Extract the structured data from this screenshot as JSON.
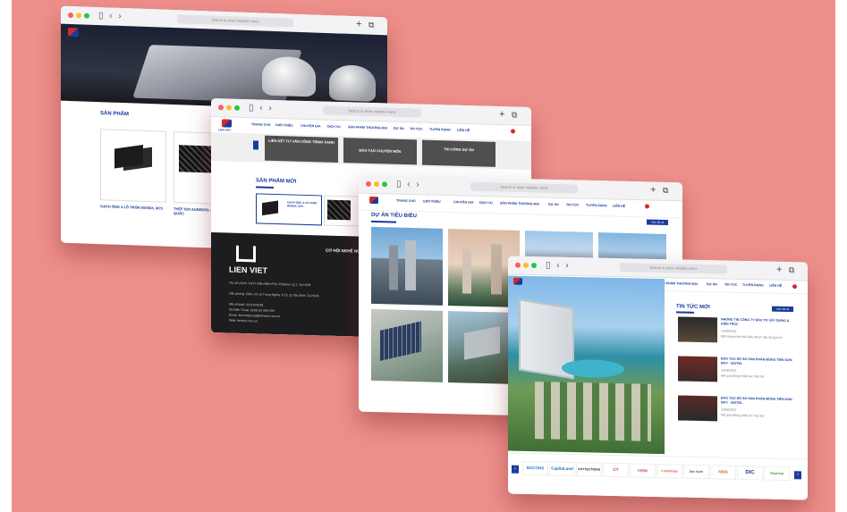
{
  "browser": {
    "address_placeholder": "Search or enter website name",
    "tab_controls": "▯ ‹ ›",
    "add_tab": "+",
    "copy_tab": "⧉"
  },
  "colors": {
    "background": "#ee8f8b",
    "brand_blue": "#1a3a9c",
    "brand_red": "#d32a2a"
  },
  "nav": {
    "home": "TRANG CHỦ",
    "about": "GIỚI THIỆU",
    "specialties": "CHUYÊN GIA",
    "services": "DỊCH VỤ",
    "products": "SẢN PHẨM THƯƠNG MẠI",
    "projects": "DỰ ÁN",
    "news": "TIN TỨC",
    "recruitment": "TUYỂN DỤNG",
    "contact": "LIÊN HỆ"
  },
  "win1": {
    "section_title": "SẢN PHẨM",
    "products": [
      "GẠCH ỐNG 4 LỖ TRÒN 80X80X, M75",
      "THÉP SỢI AUNDERS - HOSTEN VĂN QUỐC"
    ]
  },
  "win2": {
    "logo_text": "LIEN VIET",
    "banner_items": [
      "LIÊN KẾT TƯ VẤN CÔNG TRÌNH XANH",
      "ĐÀO TẠO CHUYÊN MÔN",
      "THI CÔNG DỰ ÁN"
    ],
    "section_title": "SẢN PHẨM MỚI",
    "product_caption": "GẠCH ỐNG 4 LỖ TRÒN 80X80X, M75",
    "footer_logo": "LIEN VIET",
    "footer_heading": "CƠ HỘI NGHỀ NGHIỆP",
    "footer_lines": [
      "Trụ sở chính: 14/17 Điện Biên Phủ, P.Đakao, Q.1, Tp.HCM",
      "Văn phòng: 28/4, Võ Lệ Trung Nghĩa, P.15, Q.Tân Bình, Tp.HCM",
      "Mã số thuế: 0311478284",
      "Số Điện Thoại: (028) 62 909 299",
      "Email: lienvietgroup@lienviet.com.vn",
      "Web: lienviet.com.vn"
    ]
  },
  "win3": {
    "section_title": "DỰ ÁN TIÊU BIỂU",
    "view_all": "Xem tất cả"
  },
  "win4": {
    "section_title": "TIN TỨC MỚI",
    "view_all": "Xem tất cả",
    "news": [
      {
        "title": "NHỮNG TIN CÔNG TY ĐẦU TƯ XÂY DỰNG & KIẾN TRÚC",
        "date": "15/08/2021",
        "excerpt": "Một công trình tiêu biểu được xây dựng mới"
      },
      {
        "title": "ĐÀO TẠO HỒ SƠ SẢN PHẨM ĐỒNG TIẾN SƠN MÁY - WOTEL",
        "date": "15/08/2021",
        "excerpt": "Kết quả đồng ý tiếp tục hợp tác"
      },
      {
        "title": "ĐÀO TẠO HỒ SƠ SẢN PHẨM ĐỒNG TIẾN SƠN MÁY - WOTEL",
        "date": "15/08/2021",
        "excerpt": "Kết quả đồng ý tiếp tục hợp tác"
      }
    ],
    "partners": [
      {
        "name": "BUCONS",
        "color": "#2a79c8"
      },
      {
        "name": "CapitaLand",
        "color": "#1a6fb5"
      },
      {
        "name": "COTTECTIONS",
        "color": "#222222"
      },
      {
        "name": "CT",
        "color": "#d32a2a"
      },
      {
        "name": "coop",
        "color": "#d32a2a"
      },
      {
        "name": "C-Holdings",
        "color": "#e05a2a"
      },
      {
        "name": "Dat Xanh",
        "color": "#555555"
      },
      {
        "name": "MBB",
        "color": "#c48a1a"
      },
      {
        "name": "DIC",
        "color": "#1a3a9c"
      },
      {
        "name": "Vingroup",
        "color": "#2a9a3a"
      }
    ]
  }
}
